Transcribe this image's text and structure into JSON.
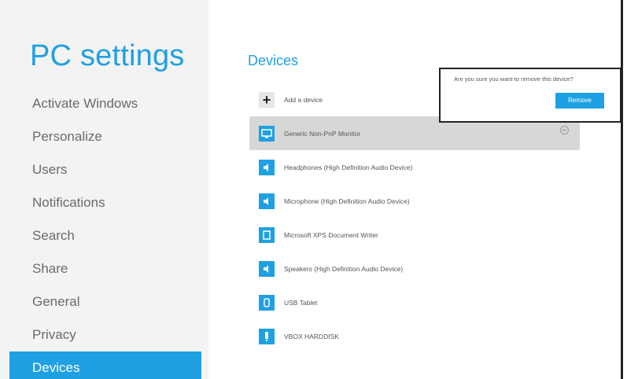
{
  "sidebar": {
    "title": "PC settings",
    "items": [
      {
        "label": "Activate Windows"
      },
      {
        "label": "Personalize"
      },
      {
        "label": "Users"
      },
      {
        "label": "Notifications"
      },
      {
        "label": "Search"
      },
      {
        "label": "Share"
      },
      {
        "label": "General"
      },
      {
        "label": "Privacy"
      },
      {
        "label": "Devices",
        "selected": true
      }
    ]
  },
  "main": {
    "section_title": "Devices",
    "devices": [
      {
        "label": "Add a device",
        "icon": "plus-icon"
      },
      {
        "label": "Generic Non-PnP Monitor",
        "icon": "monitor-icon",
        "selected": true
      },
      {
        "label": "Headphones (High Definition Audio Device)",
        "icon": "speaker-icon"
      },
      {
        "label": "Microphone (High Definition Audio Device)",
        "icon": "speaker-icon"
      },
      {
        "label": "Microsoft XPS Document Writer",
        "icon": "printer-icon"
      },
      {
        "label": "Speakers (High Definition Audio Device)",
        "icon": "speaker-icon"
      },
      {
        "label": "USB Tablet",
        "icon": "mouse-icon"
      },
      {
        "label": "VBOX HARDDISK",
        "icon": "usb-drive-icon"
      }
    ]
  },
  "flyout": {
    "message": "Are you sure you want to remove this device?",
    "button_label": "Remove"
  },
  "colors": {
    "accent": "#1fa0e3",
    "sidebar_bg": "#f3f3f3",
    "selected_row": "#d7d7d7"
  }
}
